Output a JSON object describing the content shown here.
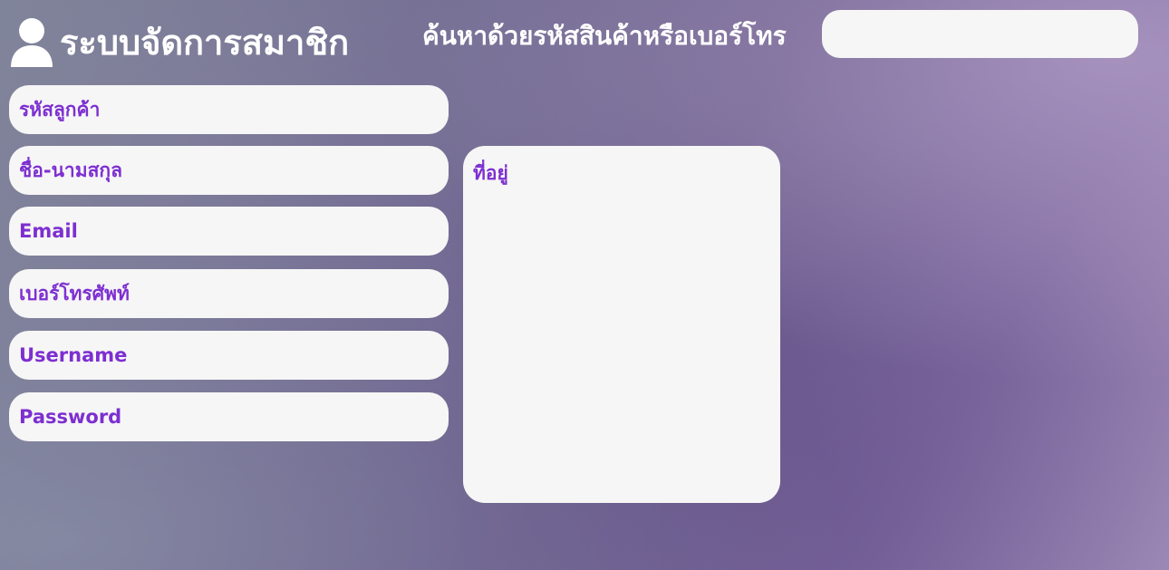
{
  "header": {
    "title": "ระบบจัดการสมาชิก",
    "icon": "user-icon"
  },
  "search": {
    "label": "ค้นหาด้วยรหัสสินค้าหรือเบอร์โทร",
    "value": "",
    "placeholder": ""
  },
  "form": {
    "customer_id": {
      "placeholder": "รหัสลูกค้า",
      "value": ""
    },
    "full_name": {
      "placeholder": "ชื่อ-นามสกุล",
      "value": ""
    },
    "email": {
      "placeholder": "Email",
      "value": ""
    },
    "phone": {
      "placeholder": "เบอร์โทรศัพท์",
      "value": ""
    },
    "username": {
      "placeholder": "Username",
      "value": ""
    },
    "password": {
      "placeholder": "Password",
      "value": ""
    },
    "address": {
      "placeholder": "ที่อยู่",
      "value": ""
    }
  },
  "colors": {
    "accent": "#7d2fd1",
    "field_background": "#f6f6f6",
    "header_text": "#ffffff"
  }
}
